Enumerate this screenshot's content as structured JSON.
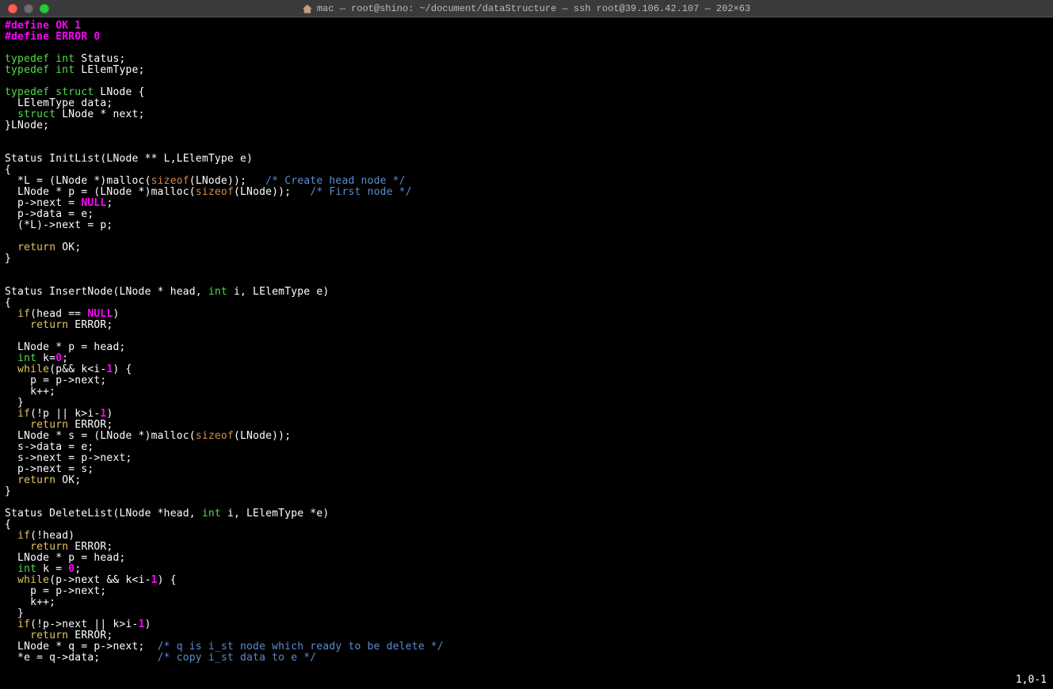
{
  "window": {
    "title": "mac — root@shino: ~/document/dataStructure — ssh root@39.106.42.107 — 202×63"
  },
  "status": {
    "position": "1,0-1"
  },
  "code": [
    [
      {
        "c": "magenta",
        "t": "#define OK "
      },
      {
        "c": "magenta",
        "t": "1"
      }
    ],
    [
      {
        "c": "magenta",
        "t": "#define ERROR "
      },
      {
        "c": "magenta",
        "t": "0"
      }
    ],
    [],
    [
      {
        "c": "green",
        "t": "typedef "
      },
      {
        "c": "green",
        "t": "int"
      },
      {
        "c": "white",
        "t": " Status;"
      }
    ],
    [
      {
        "c": "green",
        "t": "typedef "
      },
      {
        "c": "green",
        "t": "int"
      },
      {
        "c": "white",
        "t": " LElemType;"
      }
    ],
    [],
    [
      {
        "c": "green",
        "t": "typedef "
      },
      {
        "c": "green",
        "t": "struct"
      },
      {
        "c": "white",
        "t": " LNode {"
      }
    ],
    [
      {
        "c": "white",
        "t": "  LElemType data;"
      }
    ],
    [
      {
        "c": "white",
        "t": "  "
      },
      {
        "c": "green",
        "t": "struct"
      },
      {
        "c": "white",
        "t": " LNode * next;"
      }
    ],
    [
      {
        "c": "white",
        "t": "}LNode;"
      }
    ],
    [],
    [],
    [
      {
        "c": "white",
        "t": "Status InitList(LNode ** L,LElemType e)"
      }
    ],
    [
      {
        "c": "white",
        "t": "{"
      }
    ],
    [
      {
        "c": "white",
        "t": "  *L = (LNode *)malloc("
      },
      {
        "c": "orange",
        "t": "sizeof"
      },
      {
        "c": "white",
        "t": "(LNode));   "
      },
      {
        "c": "comment",
        "t": "/* Create head node */"
      }
    ],
    [
      {
        "c": "white",
        "t": "  LNode * p = (LNode *)malloc("
      },
      {
        "c": "orange",
        "t": "sizeof"
      },
      {
        "c": "white",
        "t": "(LNode));   "
      },
      {
        "c": "comment",
        "t": "/* First node */"
      }
    ],
    [
      {
        "c": "white",
        "t": "  p->next = "
      },
      {
        "c": "magenta",
        "t": "NULL"
      },
      {
        "c": "white",
        "t": ";"
      }
    ],
    [
      {
        "c": "white",
        "t": "  p->data = e;"
      }
    ],
    [
      {
        "c": "white",
        "t": "  (*L)->next = p;"
      }
    ],
    [],
    [
      {
        "c": "white",
        "t": "  "
      },
      {
        "c": "yellow",
        "t": "return"
      },
      {
        "c": "white",
        "t": " OK;"
      }
    ],
    [
      {
        "c": "white",
        "t": "}"
      }
    ],
    [],
    [],
    [
      {
        "c": "white",
        "t": "Status InsertNode(LNode * head, "
      },
      {
        "c": "green",
        "t": "int"
      },
      {
        "c": "white",
        "t": " i, LElemType e)"
      }
    ],
    [
      {
        "c": "white",
        "t": "{"
      }
    ],
    [
      {
        "c": "white",
        "t": "  "
      },
      {
        "c": "yellow",
        "t": "if"
      },
      {
        "c": "white",
        "t": "(head == "
      },
      {
        "c": "magenta",
        "t": "NULL"
      },
      {
        "c": "white",
        "t": ")"
      }
    ],
    [
      {
        "c": "white",
        "t": "    "
      },
      {
        "c": "yellow",
        "t": "return"
      },
      {
        "c": "white",
        "t": " ERROR;"
      }
    ],
    [],
    [
      {
        "c": "white",
        "t": "  LNode * p = head;"
      }
    ],
    [
      {
        "c": "white",
        "t": "  "
      },
      {
        "c": "green",
        "t": "int"
      },
      {
        "c": "white",
        "t": " k="
      },
      {
        "c": "magenta",
        "t": "0"
      },
      {
        "c": "white",
        "t": ";"
      }
    ],
    [
      {
        "c": "white",
        "t": "  "
      },
      {
        "c": "yellow",
        "t": "while"
      },
      {
        "c": "white",
        "t": "(p&& k<i-"
      },
      {
        "c": "magenta",
        "t": "1"
      },
      {
        "c": "white",
        "t": ") {"
      }
    ],
    [
      {
        "c": "white",
        "t": "    p = p->next;"
      }
    ],
    [
      {
        "c": "white",
        "t": "    k++;"
      }
    ],
    [
      {
        "c": "white",
        "t": "  }"
      }
    ],
    [
      {
        "c": "white",
        "t": "  "
      },
      {
        "c": "yellow",
        "t": "if"
      },
      {
        "c": "white",
        "t": "(!p || k>i-"
      },
      {
        "c": "magenta",
        "t": "1"
      },
      {
        "c": "white",
        "t": ")"
      }
    ],
    [
      {
        "c": "white",
        "t": "    "
      },
      {
        "c": "yellow",
        "t": "return"
      },
      {
        "c": "white",
        "t": " ERROR;"
      }
    ],
    [
      {
        "c": "white",
        "t": "  LNode * s = (LNode *)malloc("
      },
      {
        "c": "orange",
        "t": "sizeof"
      },
      {
        "c": "white",
        "t": "(LNode));"
      }
    ],
    [
      {
        "c": "white",
        "t": "  s->data = e;"
      }
    ],
    [
      {
        "c": "white",
        "t": "  s->next = p->next;"
      }
    ],
    [
      {
        "c": "white",
        "t": "  p->next = s;"
      }
    ],
    [
      {
        "c": "white",
        "t": "  "
      },
      {
        "c": "yellow",
        "t": "return"
      },
      {
        "c": "white",
        "t": " OK;"
      }
    ],
    [
      {
        "c": "white",
        "t": "}"
      }
    ],
    [],
    [
      {
        "c": "white",
        "t": "Status DeleteList(LNode *head, "
      },
      {
        "c": "green",
        "t": "int"
      },
      {
        "c": "white",
        "t": " i, LElemType *e)"
      }
    ],
    [
      {
        "c": "white",
        "t": "{"
      }
    ],
    [
      {
        "c": "white",
        "t": "  "
      },
      {
        "c": "yellow",
        "t": "if"
      },
      {
        "c": "white",
        "t": "(!head)"
      }
    ],
    [
      {
        "c": "white",
        "t": "    "
      },
      {
        "c": "yellow",
        "t": "return"
      },
      {
        "c": "white",
        "t": " ERROR;"
      }
    ],
    [
      {
        "c": "white",
        "t": "  LNode * p = head;"
      }
    ],
    [
      {
        "c": "white",
        "t": "  "
      },
      {
        "c": "green",
        "t": "int"
      },
      {
        "c": "white",
        "t": " k = "
      },
      {
        "c": "magenta",
        "t": "0"
      },
      {
        "c": "white",
        "t": ";"
      }
    ],
    [
      {
        "c": "white",
        "t": "  "
      },
      {
        "c": "yellow",
        "t": "while"
      },
      {
        "c": "white",
        "t": "(p->next && k<i-"
      },
      {
        "c": "magenta",
        "t": "1"
      },
      {
        "c": "white",
        "t": ") {"
      }
    ],
    [
      {
        "c": "white",
        "t": "    p = p->next;"
      }
    ],
    [
      {
        "c": "white",
        "t": "    k++;"
      }
    ],
    [
      {
        "c": "white",
        "t": "  }"
      }
    ],
    [
      {
        "c": "white",
        "t": "  "
      },
      {
        "c": "yellow",
        "t": "if"
      },
      {
        "c": "white",
        "t": "(!p->next || k>i-"
      },
      {
        "c": "magenta",
        "t": "1"
      },
      {
        "c": "white",
        "t": ")"
      }
    ],
    [
      {
        "c": "white",
        "t": "    "
      },
      {
        "c": "yellow",
        "t": "return"
      },
      {
        "c": "white",
        "t": " ERROR;"
      }
    ],
    [
      {
        "c": "white",
        "t": "  LNode * q = p->next;  "
      },
      {
        "c": "comment",
        "t": "/* q is i_st node which ready to be delete */"
      }
    ],
    [
      {
        "c": "white",
        "t": "  *e = q->data;         "
      },
      {
        "c": "comment",
        "t": "/* copy i_st data to e */"
      }
    ]
  ]
}
